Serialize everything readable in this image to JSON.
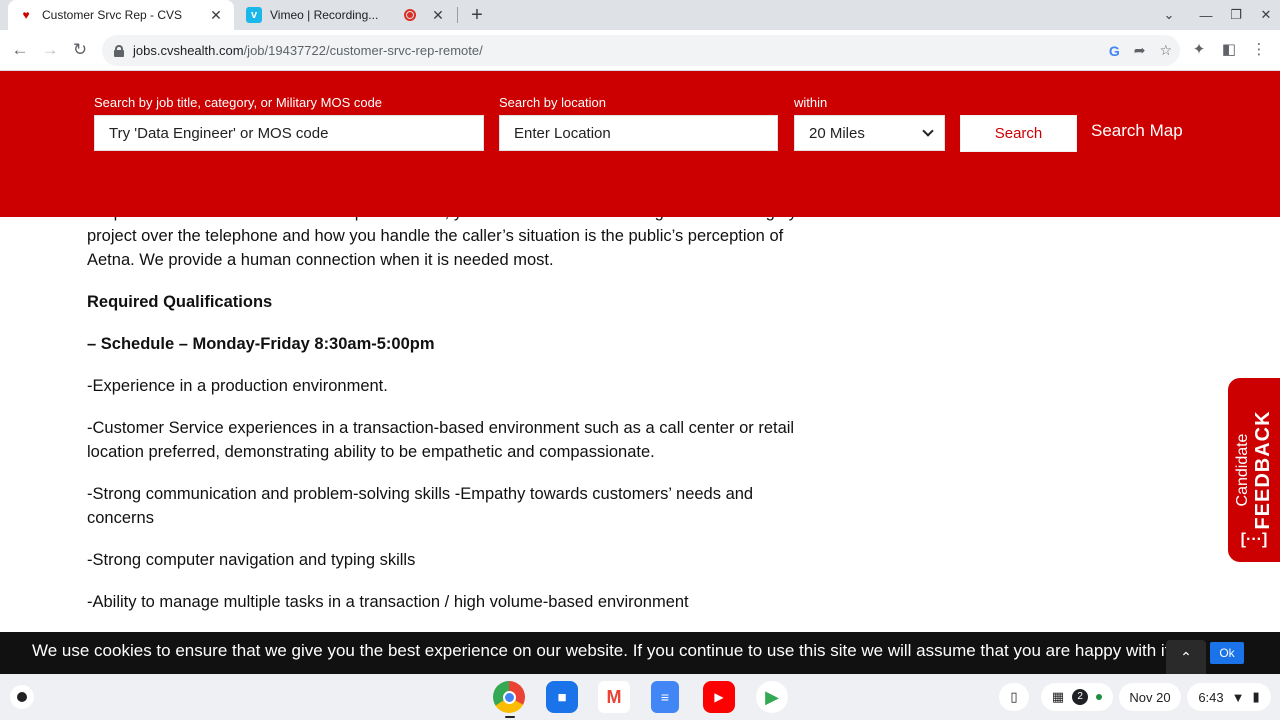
{
  "browser": {
    "tabs": [
      {
        "title": "Customer Srvc Rep - CVS",
        "favicon": "heart-icon",
        "active": true
      },
      {
        "title": "Vimeo | Recording...",
        "favicon": "vimeo-icon",
        "active": false,
        "recording": true
      }
    ],
    "new_tab_symbol": "+",
    "address": {
      "host": "jobs.cvshealth.com",
      "path": "/job/19437722/customer-srvc-rep-remote/"
    }
  },
  "search": {
    "keyword_label": "Search by job title, category, or Military MOS code",
    "keyword_placeholder": "Try 'Data Engineer' or MOS code",
    "location_label": "Search by location",
    "location_placeholder": "Enter Location",
    "within_label": "within",
    "within_value": "20 Miles",
    "search_button": "Search",
    "map_link": "Search Map",
    "accent_color": "#cc0000"
  },
  "content": {
    "intro": "hospitals. As a Customer Service Representative, you must rise to the challenge with the image you project over the telephone and how you handle the caller’s situation is the public’s perception of Aetna. We provide a human connection when it is needed most.",
    "heading": "Required Qualifications",
    "schedule": "– Schedule – Monday-Friday 8:30am-5:00pm",
    "items": [
      "-Experience in a production environment.",
      "-Customer Service experiences in a transaction-based environment such as a call center or retail location preferred, demonstrating ability to be empathetic and compassionate.",
      "-Strong communication and problem-solving skills -Empathy towards customers’ needs and concerns",
      "-Strong computer navigation and typing skills",
      "-Ability to manage multiple tasks in a transaction / high volume-based environment"
    ]
  },
  "feedback": {
    "line1": "Candidate",
    "line2": "FEEDBACK",
    "icon": "[···]"
  },
  "cookie": {
    "text": "We use cookies to ensure that we give you the best experience on our website. If you continue to use this site we will assume that you are happy with it.",
    "ok": "Ok"
  },
  "shelf": {
    "apps": [
      "chrome-icon",
      "files-icon",
      "gmail-icon",
      "docs-icon",
      "youtube-icon",
      "play-store-icon"
    ],
    "notification_count": "2",
    "date": "Nov 20",
    "time": "6:43"
  }
}
